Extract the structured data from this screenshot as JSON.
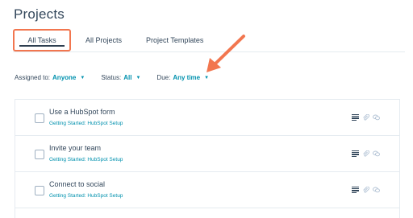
{
  "page": {
    "title": "Projects"
  },
  "tabs": [
    {
      "label": "All Tasks",
      "active": true
    },
    {
      "label": "All Projects",
      "active": false
    },
    {
      "label": "Project Templates",
      "active": false
    }
  ],
  "filters": {
    "assigned": {
      "label": "Assigned to:",
      "value": "Anyone"
    },
    "status": {
      "label": "Status:",
      "value": "All"
    },
    "due": {
      "label": "Due:",
      "value": "Any time"
    }
  },
  "tasks": [
    {
      "title": "Use a HubSpot form",
      "project": "Getting Started: HubSpot Setup"
    },
    {
      "title": "Invite your team",
      "project": "Getting Started: HubSpot Setup"
    },
    {
      "title": "Connect to social",
      "project": "Getting Started: HubSpot Setup"
    }
  ],
  "colors": {
    "accent": "#0091ae",
    "highlight": "#f2764f",
    "text": "#33475b"
  },
  "icons": [
    "notes-icon",
    "attachment-icon",
    "comment-icon",
    "caret-down-icon",
    "arrow-icon"
  ]
}
